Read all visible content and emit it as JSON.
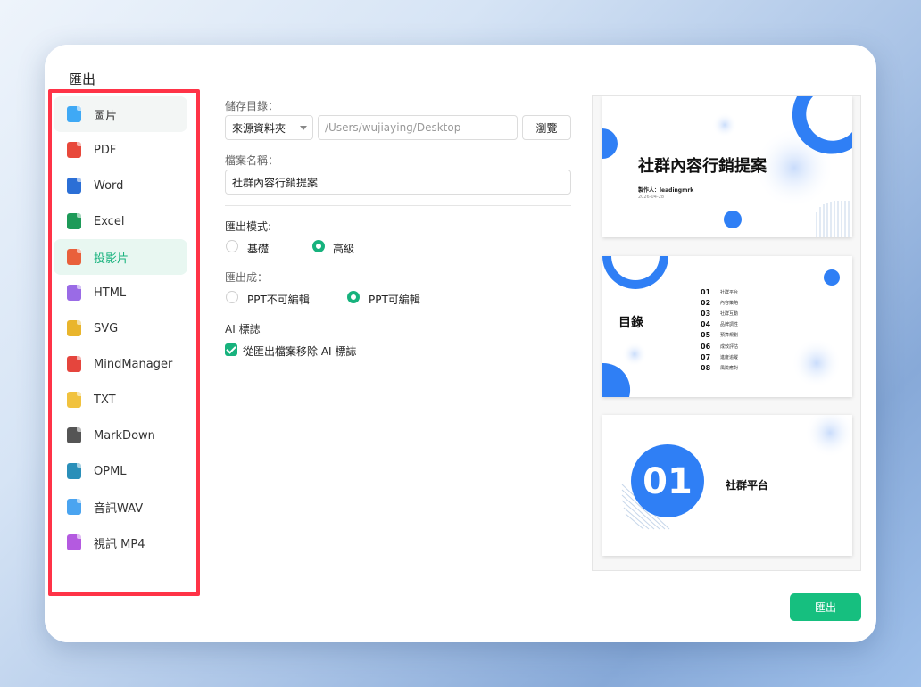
{
  "window": {
    "title": "匯出"
  },
  "sidebar": {
    "items": [
      {
        "label": "圖片",
        "icon": "image-file-icon",
        "color": "#3fa9f5"
      },
      {
        "label": "PDF",
        "icon": "pdf-file-icon",
        "color": "#e8483b"
      },
      {
        "label": "Word",
        "icon": "word-file-icon",
        "color": "#2b6fd6"
      },
      {
        "label": "Excel",
        "icon": "excel-file-icon",
        "color": "#1d9a58"
      },
      {
        "label": "投影片",
        "icon": "ppt-file-icon",
        "color": "#e9603b"
      },
      {
        "label": "HTML",
        "icon": "html-file-icon",
        "color": "#9a6be6"
      },
      {
        "label": "SVG",
        "icon": "svg-file-icon",
        "color": "#e9b52c"
      },
      {
        "label": "MindManager",
        "icon": "mindmanager-file-icon",
        "color": "#e5453d"
      },
      {
        "label": "TXT",
        "icon": "txt-file-icon",
        "color": "#f1c23e"
      },
      {
        "label": "MarkDown",
        "icon": "markdown-file-icon",
        "color": "#555555"
      },
      {
        "label": "OPML",
        "icon": "opml-file-icon",
        "color": "#2a8fb9"
      },
      {
        "label": "音訊WAV",
        "icon": "audio-file-icon",
        "color": "#4aa4f0"
      },
      {
        "label": "視訊 MP4",
        "icon": "video-file-icon",
        "color": "#b45ae0"
      }
    ],
    "active_index": 4
  },
  "form": {
    "save_dir_label": "儲存目錄：",
    "source_select": "來源資料夾",
    "path_placeholder": "/Users/wujiaying/Desktop",
    "browse_button": "瀏覽",
    "filename_label": "檔案名稱：",
    "filename_value": "社群內容行銷提案",
    "mode_label": "匯出模式:",
    "mode_basic": "基礎",
    "mode_advanced": "高級",
    "export_as_label": "匯出成：",
    "ppt_readonly": "PPT不可編輯",
    "ppt_editable": "PPT可編輯",
    "ai_label": "AI 標誌",
    "ai_checkbox_label": "從匯出檔案移除 AI 標誌",
    "ai_checked": true,
    "selected_mode": "高級",
    "selected_export": "PPT可編輯"
  },
  "preview": {
    "slide1": {
      "title": "社群內容行銷提案",
      "author": "製作人：leadingmrk",
      "date": "2026-04-28"
    },
    "slide2": {
      "title": "目錄",
      "items": [
        {
          "num": "01",
          "text": "社群平台"
        },
        {
          "num": "02",
          "text": "內容策略"
        },
        {
          "num": "03",
          "text": "社群互動"
        },
        {
          "num": "04",
          "text": "品牌調性"
        },
        {
          "num": "05",
          "text": "預算規劃"
        },
        {
          "num": "06",
          "text": "成效評估"
        },
        {
          "num": "07",
          "text": "進度追蹤"
        },
        {
          "num": "08",
          "text": "風險應對"
        }
      ]
    },
    "slide3": {
      "number": "01",
      "title": "社群平台"
    }
  },
  "footer": {
    "export_button": "匯出"
  },
  "colors": {
    "accent": "#17b27d",
    "slide_blue": "#2f7ff5",
    "highlight_border": "#ff3347"
  }
}
